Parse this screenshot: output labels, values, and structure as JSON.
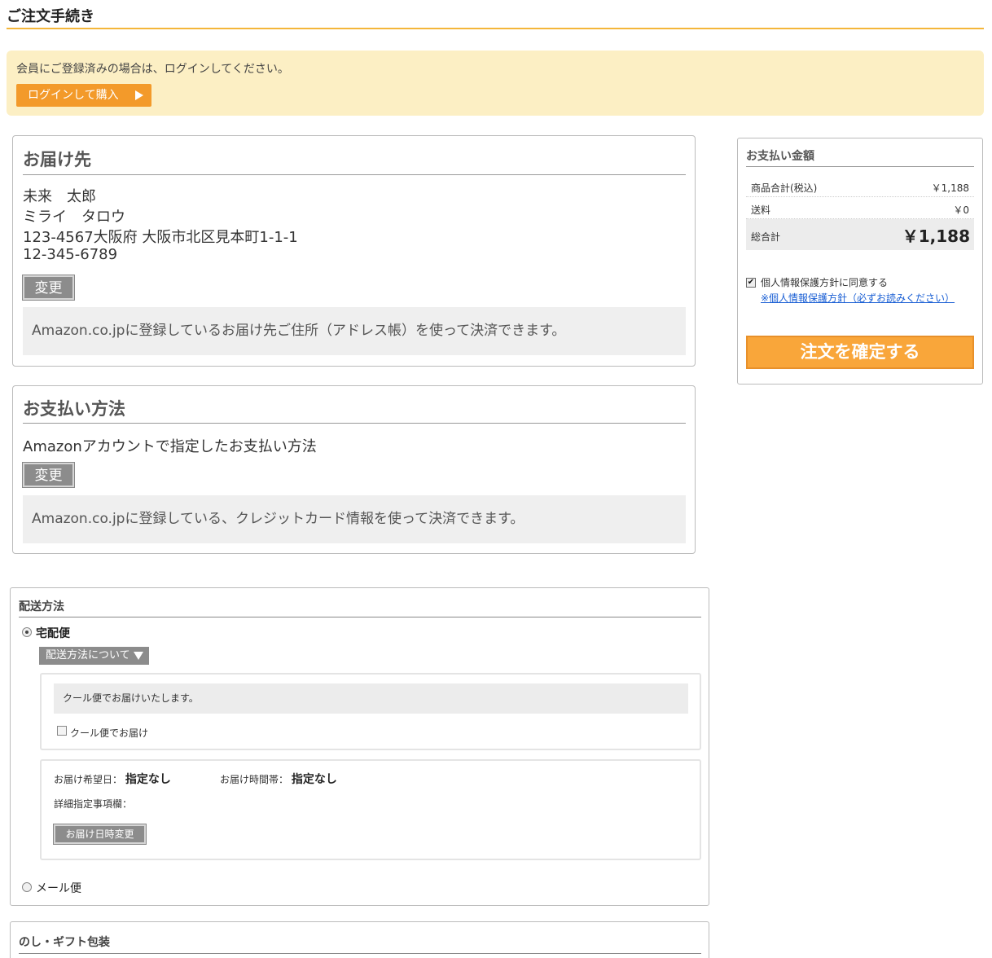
{
  "page": {
    "title": "ご注文手続き"
  },
  "login": {
    "message": "会員にご登録済みの場合は、ログインしてください。",
    "button_label": "ログインして購入"
  },
  "delivery": {
    "heading": "お届け先",
    "name": "未来　太郎",
    "kana": "ミライ　タロウ",
    "address": "123-4567大阪府 大阪市北区見本町1-1-1",
    "phone": "12-345-6789",
    "change_label": "変更",
    "note": "Amazon.co.jpに登録しているお届け先ご住所（アドレス帳）を使って決済できます。"
  },
  "payment": {
    "heading": "お支払い方法",
    "method": "Amazonアカウントで指定したお支払い方法",
    "change_label": "変更",
    "note": "Amazon.co.jpに登録している、クレジットカード情報を使って決済できます。"
  },
  "summary": {
    "heading": "お支払い金額",
    "rows": [
      {
        "label": "商品合計(税込)",
        "value": "￥1,188"
      },
      {
        "label": "送料",
        "value": "￥0"
      }
    ],
    "total_label": "総合計",
    "total_value": "￥1,188",
    "agree_checked": true,
    "agree_label": "個人情報保護方針に同意する",
    "policy_link": "※個人情報保護方針（必ずお読みください）",
    "confirm_label": "注文を確定する"
  },
  "shipping": {
    "heading": "配送方法",
    "options": [
      {
        "label": "宅配便",
        "selected": true
      },
      {
        "label": "メール便",
        "selected": false
      }
    ],
    "about_label": "配送方法について",
    "cool_note": "クール便でお届けいたします。",
    "cool_checkbox_label": "クール便でお届け",
    "date_label": "お届け希望日：",
    "date_value": "指定なし",
    "time_label": "お届け時間帯：",
    "time_value": "指定なし",
    "detail_label": "詳細指定事項欄：",
    "date_change_label": "お届け日時変更"
  },
  "gift": {
    "heading": "のし・ギフト包装"
  },
  "colors": {
    "accent": "#f39a2a",
    "notice_bg": "#fcefc4",
    "title_rule": "#f4b63a",
    "link": "#1a5fd4"
  }
}
